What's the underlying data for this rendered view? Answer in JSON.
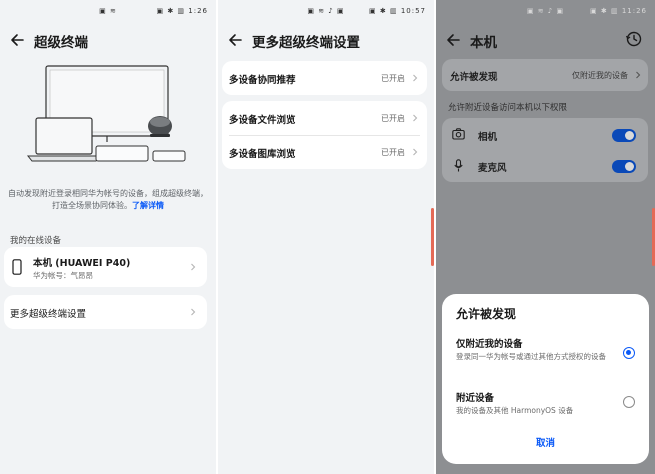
{
  "screen1": {
    "status": {
      "icons": "▣ ≋",
      "right": "▣ ✱ ▥ 1:26"
    },
    "title": "超级终端",
    "description": "自动发现附近登录相同华为帐号的设备，组成超级终端，打造全场景协同体验。",
    "learn_more": "了解详情",
    "online_label": "我的在线设备",
    "device": {
      "name": "本机 (HUAWEI P40)",
      "account": "华为帐号：气昂昂"
    },
    "more_settings": "更多超级终端设置"
  },
  "screen2": {
    "status": {
      "icons": "▣ ≋ ♪ ▣",
      "right": "▣ ✱ ▥ 10:57"
    },
    "title": "更多超级终端设置",
    "rows": [
      {
        "label": "多设备协同推荐",
        "value": "已开启"
      },
      {
        "label": "多设备文件浏览",
        "value": "已开启"
      },
      {
        "label": "多设备图库浏览",
        "value": "已开启"
      }
    ]
  },
  "screen3": {
    "status": {
      "icons": "▣ ≋ ♪ ▣",
      "right": "▣ ✱ ▥ 11:26"
    },
    "title": "本机",
    "discovery": {
      "label": "允许被发现",
      "value": "仅附近我的设备"
    },
    "permissions_label": "允许附近设备访问本机以下权限",
    "permissions": [
      {
        "label": "相机",
        "enabled": true
      },
      {
        "label": "麦克风",
        "enabled": true
      }
    ],
    "sheet": {
      "title": "允许被发现",
      "options": [
        {
          "title": "仅附近我的设备",
          "subtitle": "登录同一华为帐号或通过其他方式授权的设备",
          "selected": true
        },
        {
          "title": "附近设备",
          "subtitle": "我的设备及其他 HarmonyOS 设备",
          "selected": false
        }
      ],
      "cancel": "取消"
    }
  },
  "colors": {
    "accent": "#0a59f7",
    "background": "#f1f3f5",
    "dim_background": "#8d8f92"
  }
}
